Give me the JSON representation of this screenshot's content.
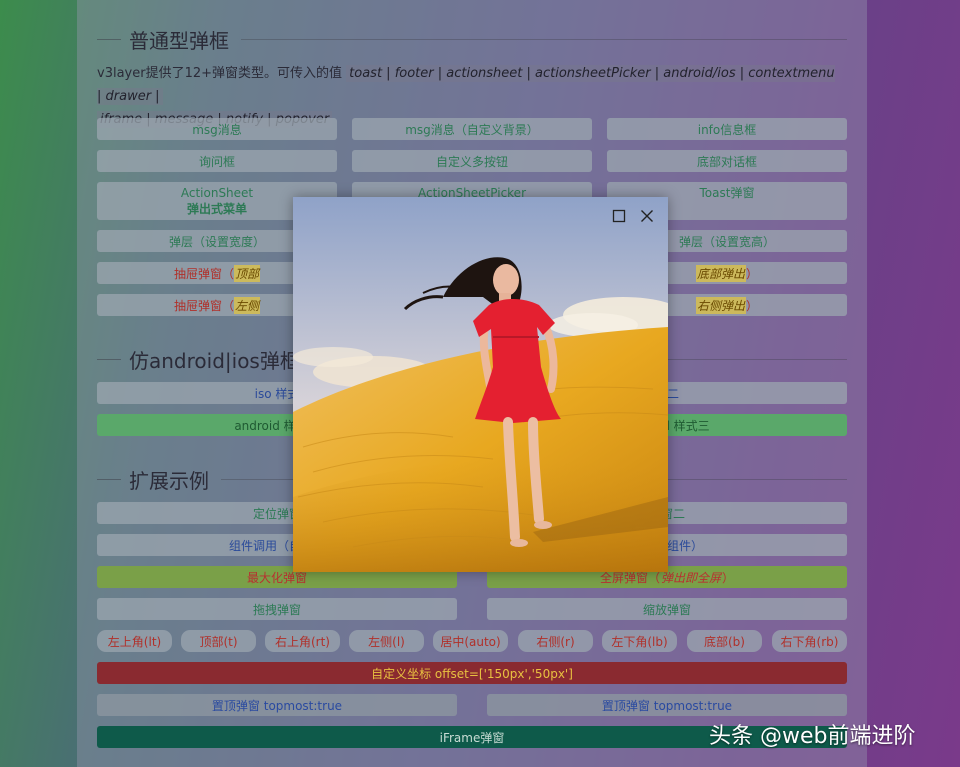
{
  "sections": {
    "basic": "普通型弹框",
    "android_ios": "仿android|ios弹框",
    "extend": "扩展示例"
  },
  "desc": {
    "prefix": "v3layer提供了12+弹窗类型。可传入的值",
    "types_line1": "toast | footer | actionsheet | actionsheetPicker | android/ios | contextmenu | drawer |",
    "types_line2": "iframe | message | notify | popover"
  },
  "buttons": {
    "msg": "msg消息",
    "msg_custom_bg": "msg消息（自定义背景）",
    "info": "info信息框",
    "confirm": "询问框",
    "multi_btn": "自定义多按钮",
    "footer_dialog": "底部对话框",
    "actionsheet_1": "ActionSheet",
    "actionsheet_2": "弹出式菜单",
    "actionsheet_picker": "ActionSheetPicker",
    "toast": "Toast弹窗",
    "width": "弹层（设置宽度）",
    "width_height": "弹层（设置宽高）",
    "drawer_top_prefix": "抽屉弹窗（",
    "drawer_top_em": "顶部",
    "drawer_bottom_em": "底部弹出",
    "drawer_bottom_suffix": "）",
    "drawer_left_prefix": "抽屉弹窗（",
    "drawer_left_em": "左侧",
    "drawer_right_em": "右侧弹出",
    "drawer_right_suffix": "）",
    "ios_1": "iso 样式",
    "ios_2": "式二",
    "android_1": "android 样式一",
    "android_3": "android 样式三",
    "position_1": "定位弹窗",
    "position_2": "弹窗二",
    "component_1": "组件调用（自定义",
    "component_2": "入外部组件）",
    "maximize": "最大化弹窗",
    "fullscreen_prefix": "全屏弹窗（",
    "fullscreen_em": "弹出即全屏",
    "fullscreen_suffix": "）",
    "drag": "拖拽弹窗",
    "resize": "缩放弹窗",
    "lt": "左上角(lt)",
    "t": "顶部(t)",
    "rt": "右上角(rt)",
    "l": "左侧(l)",
    "auto": "居中(auto)",
    "r": "右侧(r)",
    "lb": "左下角(lb)",
    "b": "底部(b)",
    "rb": "右下角(rb)",
    "offset": "自定义坐标 offset=['150px','50px']",
    "topmost_1": "置顶弹窗 topmost:true",
    "topmost_2": "置顶弹窗 topmost:true",
    "iframe": "iFrame弹窗"
  },
  "popup": {
    "maximize_icon": "maximize-icon",
    "close_icon": "close-icon"
  },
  "watermark": "头条 @web前端进阶",
  "colors": {
    "text_green": "#2d7a55",
    "text_red": "#b0302a",
    "text_blue": "#2a4a9a",
    "green_btn": "#5aa86a",
    "olive_btn": "#7aa048",
    "darkred_btn": "#8a2a30",
    "teal_btn": "#0e5a4a"
  }
}
